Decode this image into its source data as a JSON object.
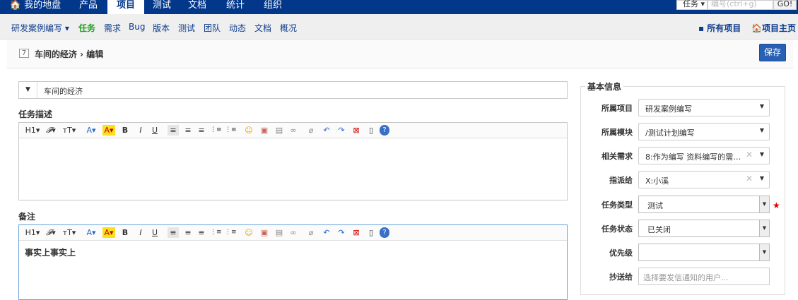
{
  "topnav": {
    "items": [
      {
        "label": "🏠 我的地盘"
      },
      {
        "label": "产品"
      },
      {
        "label": "项目"
      },
      {
        "label": "测试"
      },
      {
        "label": "文档"
      },
      {
        "label": "统计"
      },
      {
        "label": "组织"
      }
    ],
    "active_index": 2,
    "search": {
      "type_label": "任务 ▾",
      "placeholder": "编号(ctrl+g)",
      "go_label": "GO!"
    }
  },
  "subnav": {
    "project_switcher": "研发案例编写 ▾",
    "links": [
      "任务",
      "需求",
      "Bug",
      "版本",
      "测试",
      "团队",
      "动态",
      "文档",
      "概况"
    ],
    "active_link": "任务",
    "all_projects": "▪ 所有项目",
    "project_home": "🏠项目主页"
  },
  "header": {
    "id": "7",
    "title": "车间的经济 › 编辑",
    "save_label": "保存"
  },
  "form": {
    "name_value": "车间的经济",
    "desc_label": "任务描述",
    "comment_label": "备注",
    "comment_content": "事实上事实上"
  },
  "toolbar_items": [
    "H1▾",
    "𝓕▾",
    "тT▾",
    "A▾",
    "A▾",
    "B",
    "I",
    "U",
    "≡",
    "≡",
    "≡",
    "⋮≡",
    "⋮≡",
    "☺",
    "▣",
    "▤",
    "∞",
    "⌀",
    "↶",
    "↷",
    "⊠",
    "▯",
    "?"
  ],
  "sidebar": {
    "title": "基本信息",
    "fields": [
      {
        "label": "所属项目",
        "value": "研发案例编写"
      },
      {
        "label": "所属模块",
        "value": "/测试计划编写"
      },
      {
        "label": "相关需求",
        "value": "8:作为编写 资料编写的需…"
      },
      {
        "label": "指派给",
        "value": "X:小溪"
      },
      {
        "label": "任务类型",
        "value": "测试"
      },
      {
        "label": "任务状态",
        "value": "已关闭"
      },
      {
        "label": "优先级",
        "value": ""
      },
      {
        "label": "抄送给",
        "placeholder": "选择要发信通知的用户..."
      }
    ]
  },
  "colors": {
    "nav_bg": "#03378a",
    "active_link": "#229f24",
    "save_button": "#2860b3"
  }
}
